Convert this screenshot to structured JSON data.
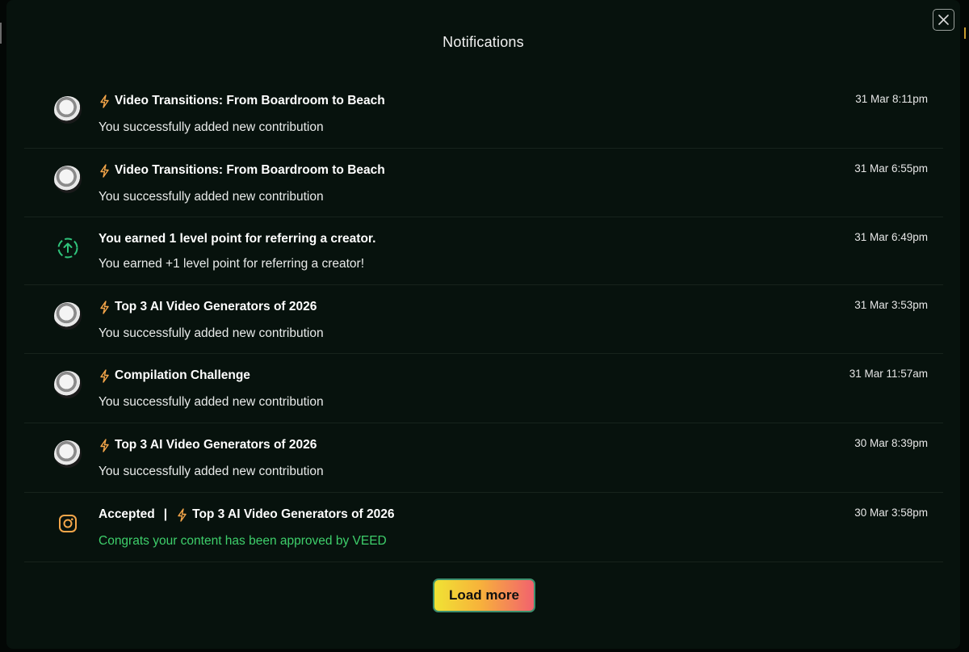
{
  "modal": {
    "title": "Notifications",
    "load_more_label": "Load more"
  },
  "notifications": [
    {
      "icon": "avatar",
      "title": "Video Transitions: From Boardroom to Beach",
      "message": "You successfully added new contribution",
      "time": "31 Mar 8:11pm"
    },
    {
      "icon": "avatar",
      "title": "Video Transitions: From Boardroom to Beach",
      "message": "You successfully added new contribution",
      "time": "31 Mar 6:55pm"
    },
    {
      "icon": "level-up-icon",
      "title": "You earned 1 level point for referring a creator.",
      "message": "You earned +1 level point for referring a creator!",
      "time": "31 Mar 6:49pm"
    },
    {
      "icon": "avatar",
      "title": "Top 3 AI Video Generators of 2026",
      "message": "You successfully added new contribution",
      "time": "31 Mar 3:53pm"
    },
    {
      "icon": "avatar",
      "title": "Compilation Challenge",
      "message": "You successfully added new contribution",
      "time": "31 Mar 11:57am"
    },
    {
      "icon": "avatar",
      "title": "Top 3 AI Video Generators of 2026",
      "message": "You successfully added new contribution",
      "time": "30 Mar 8:39pm"
    },
    {
      "icon": "instagram-icon",
      "status": "Accepted",
      "separator": "|",
      "title": "Top 3 AI Video Generators of 2026",
      "message": "Congrats your content has been approved by VEED",
      "time": "30 Mar 3:58pm"
    }
  ],
  "colors": {
    "bolt": "#f5a64a",
    "approved_message": "#3ecf6b",
    "level_up": "#2fc27a",
    "instagram": "#f5a64a"
  }
}
